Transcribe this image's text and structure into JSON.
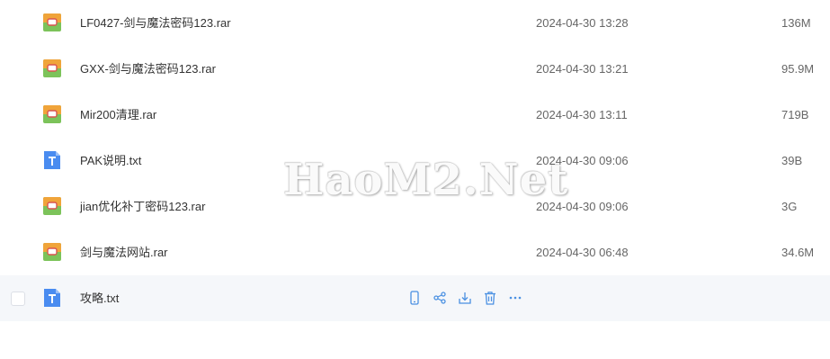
{
  "files": [
    {
      "name": "LF0427-剑与魔法密码123.rar",
      "date": "2024-04-30 13:28",
      "size": "136M",
      "icon": "rar-archive-icon"
    },
    {
      "name": "GXX-剑与魔法密码123.rar",
      "date": "2024-04-30 13:21",
      "size": "95.9M",
      "icon": "rar-archive-icon"
    },
    {
      "name": "Mir200清理.rar",
      "date": "2024-04-30 13:11",
      "size": "719B",
      "icon": "rar-archive-icon"
    },
    {
      "name": "PAK说明.txt",
      "date": "2024-04-30 09:06",
      "size": "39B",
      "icon": "text-file-icon"
    },
    {
      "name": "jian优化补丁密码123.rar",
      "date": "2024-04-30 09:06",
      "size": "3G",
      "icon": "rar-archive-icon"
    },
    {
      "name": "剑与魔法网站.rar",
      "date": "2024-04-30 06:48",
      "size": "34.6M",
      "icon": "rar-archive-icon"
    },
    {
      "name": "攻略.txt",
      "date": "",
      "size": "",
      "icon": "text-file-icon"
    }
  ],
  "hover_row_actions": [
    "phone-icon",
    "share-icon",
    "download-icon",
    "delete-icon",
    "more-icon"
  ],
  "watermark": "HaoM2.Net",
  "colors": {
    "accent": "#4a90e2",
    "hover_bg": "#f5f7fa",
    "txt_icon": "#4a8cf0",
    "rar_top": "#f0a43a",
    "rar_bottom": "#7cc35a"
  }
}
